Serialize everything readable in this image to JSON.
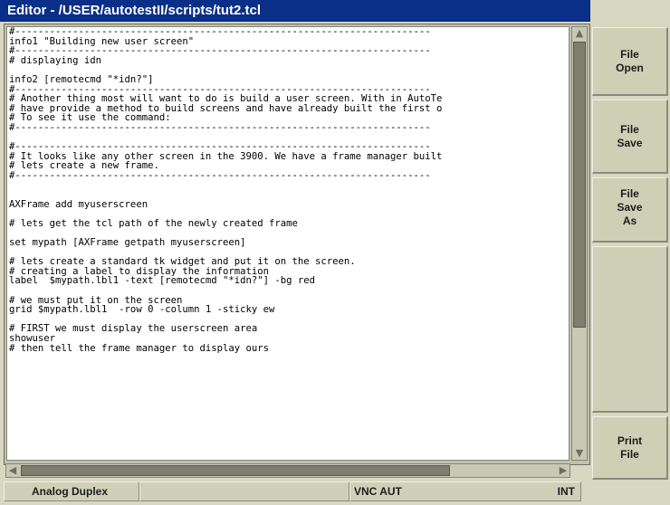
{
  "window": {
    "title": "Editor - /USER/autotestII/scripts/tut2.tcl"
  },
  "editor": {
    "lines": [
      "#------------------------------------------------------------------------",
      "info1 \"Building new user screen\"",
      "#------------------------------------------------------------------------",
      "# displaying idn",
      "",
      "info2 [remotecmd \"*idn?\"]",
      "#------------------------------------------------------------------------",
      "# Another thing most will want to do is build a user screen. With in AutoTe",
      "# have provide a method to build screens and have already built the first o",
      "# To see it use the command:",
      "#------------------------------------------------------------------------",
      "",
      "#------------------------------------------------------------------------",
      "# It looks like any other screen in the 3900. We have a frame manager built",
      "# lets create a new frame.",
      "#------------------------------------------------------------------------",
      "",
      "",
      "AXFrame add myuserscreen",
      "",
      "# lets get the tcl path of the newly created frame",
      "",
      "set mypath [AXFrame getpath myuserscreen]",
      "",
      "# lets create a standard tk widget and put it on the screen.",
      "# creating a label to display the information",
      "label  $mypath.lbl1 -text [remotecmd \"*idn?\"] -bg red",
      "",
      "# we must put it on the screen",
      "grid $mypath.lbl1  -row 0 -column 1 -sticky ew",
      "",
      "# FIRST we must display the userscreen area",
      "showuser",
      "# then tell the frame manager to display ours"
    ]
  },
  "scrollbars": {
    "vertical": {
      "up_icon": "triangle-up",
      "down_icon": "triangle-down"
    },
    "horizontal": {
      "left_icon": "triangle-left",
      "right_icon": "triangle-right"
    }
  },
  "softkeys": {
    "file_open": "File\nOpen",
    "file_save": "File\nSave",
    "file_save_as": "File\nSave\nAs",
    "print_file": "Print\nFile"
  },
  "status": {
    "mode": "Analog Duplex",
    "blank": "",
    "vnc": "VNC AUT",
    "ref": "INT"
  }
}
